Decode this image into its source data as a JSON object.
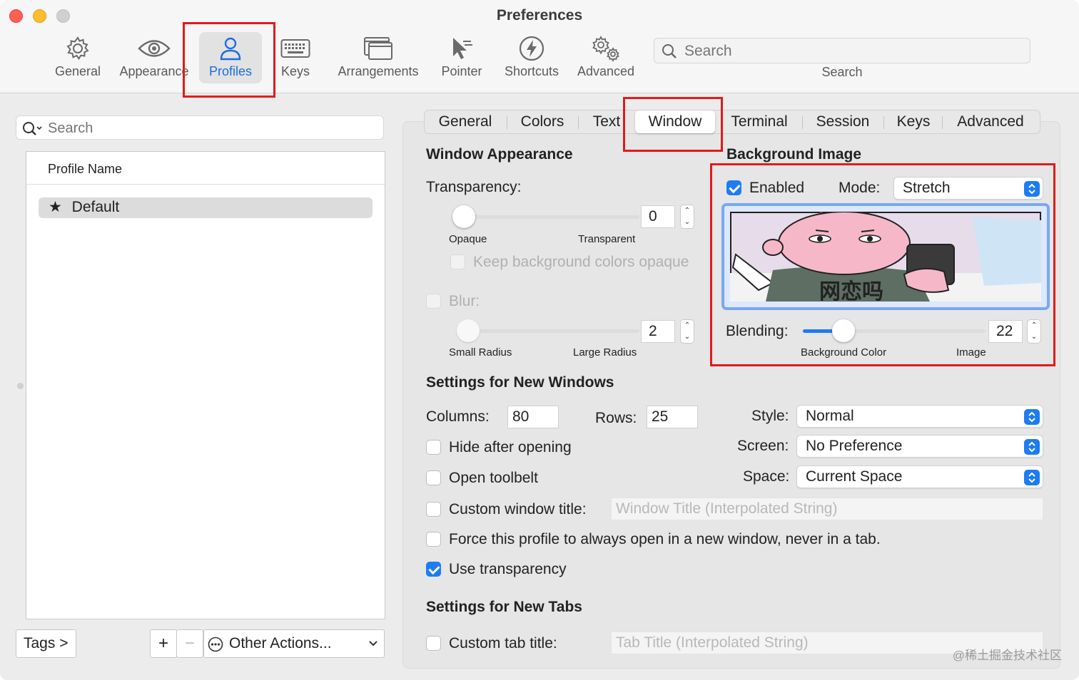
{
  "window": {
    "title": "Preferences"
  },
  "toolbar": {
    "items": [
      {
        "label": "General",
        "icon": "gear-icon"
      },
      {
        "label": "Appearance",
        "icon": "eye-icon"
      },
      {
        "label": "Profiles",
        "icon": "person-icon"
      },
      {
        "label": "Keys",
        "icon": "keyboard-icon"
      },
      {
        "label": "Arrangements",
        "icon": "windows-icon"
      },
      {
        "label": "Pointer",
        "icon": "cursor-icon"
      },
      {
        "label": "Shortcuts",
        "icon": "bolt-icon"
      },
      {
        "label": "Advanced",
        "icon": "gears-icon"
      }
    ],
    "selected": "Profiles",
    "search_placeholder": "Search",
    "search_caption": "Search",
    "accent": "#1a6ce6"
  },
  "sidebar": {
    "search_placeholder": "Search",
    "column_header": "Profile Name",
    "profiles": [
      {
        "name": "Default",
        "default_marker": "★"
      }
    ],
    "tags_button": "Tags >",
    "add_button": "+",
    "remove_button": "−",
    "other_actions": "Other Actions..."
  },
  "tabs": {
    "items": [
      "General",
      "Colors",
      "Text",
      "Window",
      "Terminal",
      "Session",
      "Keys",
      "Advanced"
    ],
    "selected": "Window"
  },
  "window_appearance": {
    "heading": "Window Appearance",
    "transparency_label": "Transparency:",
    "transparency_value": "0",
    "transparency_min": "Opaque",
    "transparency_max": "Transparent",
    "keep_opaque_label": "Keep background colors opaque",
    "blur_label": "Blur:",
    "blur_value": "2",
    "blur_min": "Small Radius",
    "blur_max": "Large Radius"
  },
  "background_image": {
    "heading": "Background Image",
    "enabled_label": "Enabled",
    "enabled": true,
    "mode_label": "Mode:",
    "mode_value": "Stretch",
    "blending_label": "Blending:",
    "blending_value": "22",
    "blending_fraction": 0.22,
    "blending_min": "Background Color",
    "blending_max": "Image",
    "image_caption": "网恋吗"
  },
  "new_windows": {
    "heading": "Settings for New Windows",
    "columns_label": "Columns:",
    "columns_value": "80",
    "rows_label": "Rows:",
    "rows_value": "25",
    "style_label": "Style:",
    "style_value": "Normal",
    "screen_label": "Screen:",
    "screen_value": "No Preference",
    "space_label": "Space:",
    "space_value": "Current Space",
    "hide_after_opening": "Hide after opening",
    "open_toolbelt": "Open toolbelt",
    "custom_window_title": "Custom window title:",
    "window_title_placeholder": "Window Title (Interpolated String)",
    "force_new_window": "Force this profile to always open in a new window, never in a tab.",
    "use_transparency": "Use transparency",
    "use_transparency_checked": true
  },
  "new_tabs": {
    "heading": "Settings for New Tabs",
    "custom_tab_title": "Custom tab title:",
    "tab_title_placeholder": "Tab Title (Interpolated String)"
  },
  "watermark": "@稀土掘金技术社区"
}
